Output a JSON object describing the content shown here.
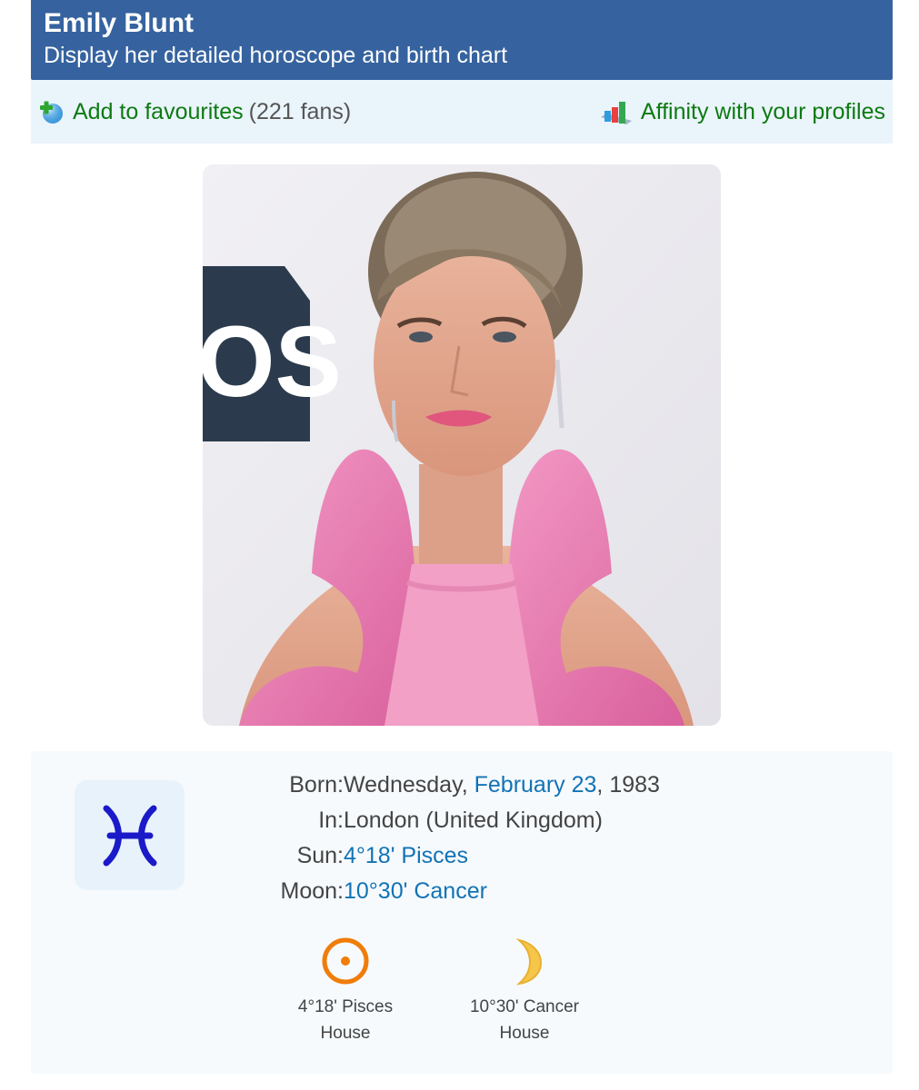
{
  "header": {
    "name": "Emily Blunt",
    "subtitle": "Display her detailed horoscope and birth chart"
  },
  "actions": {
    "favourites_label": "Add to favourites",
    "favourites_count": "(221 fans)",
    "affinity_label": "Affinity with your profiles",
    "favourites_icon": "add-favourite-icon",
    "affinity_icon": "bar-chart-icon"
  },
  "photo": {
    "icon": "portrait-photo",
    "background_text": "OS"
  },
  "info": {
    "sign_icon": "pisces-icon",
    "born_label": "Born:",
    "born_day": "Wednesday,",
    "born_date": "February 23",
    "born_year": ", 1983",
    "in_label": "In:",
    "in_value": "London (United Kingdom)",
    "sun_label": "Sun:",
    "sun_value": "4°18' Pisces",
    "moon_label": "Moon:",
    "moon_value": "10°30' Cancer"
  },
  "planets": [
    {
      "icon": "sun-icon",
      "position": "4°18' Pisces",
      "house": "House"
    },
    {
      "icon": "moon-icon",
      "position": "10°30' Cancer",
      "house": "House"
    }
  ],
  "colors": {
    "header_bg": "#36639f",
    "link": "#1273b5",
    "action_green": "#0d7a12",
    "sign_blue": "#1a1ac8"
  }
}
